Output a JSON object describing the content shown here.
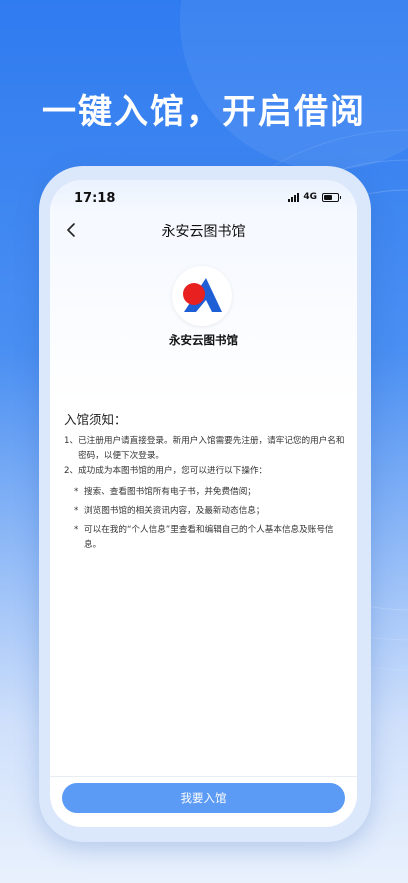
{
  "headline": "一键入馆，开启借阅",
  "status_bar": {
    "time": "17:18",
    "network": "4G",
    "battery_level": 0.6
  },
  "nav": {
    "title": "永安云图书馆"
  },
  "library": {
    "name": "永安云图书馆",
    "logo_colors": {
      "circle": "#e8201f",
      "triangle": "#1f5fd6"
    }
  },
  "notice": {
    "title": "入馆须知：",
    "items": [
      {
        "num": "1、",
        "text": "已注册用户请直接登录。新用户入馆需要先注册，请牢记您的用户名和密码，以便下次登录。"
      },
      {
        "num": "2、",
        "text": "成功成为本图书馆的用户，您可以进行以下操作："
      }
    ],
    "sub_items": [
      {
        "bullet": "*",
        "text": "搜索、查看图书馆所有电子书，并免费借阅；"
      },
      {
        "bullet": "*",
        "text": "浏览图书馆的相关资讯内容，及最新动态信息；"
      },
      {
        "bullet": "*",
        "text": "可以在我的“个人信息”里查看和编辑自己的个人基本信息及账号信息。"
      }
    ]
  },
  "join_button": {
    "label": "我要入馆"
  },
  "colors": {
    "accent": "#5b9af5",
    "background_top": "#2f7bf0"
  }
}
